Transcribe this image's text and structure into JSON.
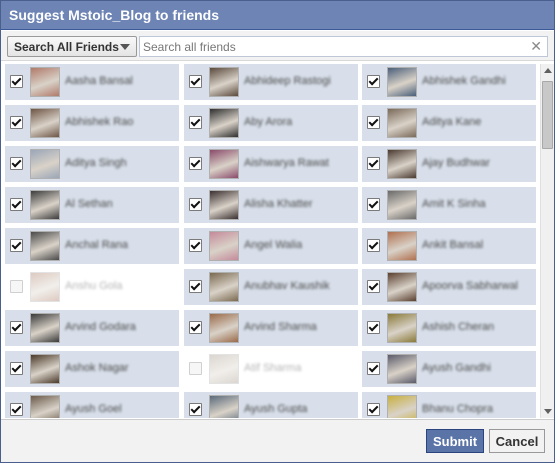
{
  "dialog": {
    "title": "Suggest Mstoic_Blog to friends"
  },
  "toolbar": {
    "filter_label": "Search All Friends",
    "search_placeholder": "Search all friends",
    "clear_icon": "close-icon"
  },
  "friends": [
    {
      "name": "Aasha Bansal",
      "checked": true,
      "color": "#b07a6a"
    },
    {
      "name": "Abhideep Rastogi",
      "checked": true,
      "color": "#5a4a3c"
    },
    {
      "name": "Abhishek Gandhi",
      "checked": true,
      "color": "#4a5f7a"
    },
    {
      "name": "Abhishek Rao",
      "checked": true,
      "color": "#6e5545"
    },
    {
      "name": "Aby Arora",
      "checked": true,
      "color": "#2f2f2f"
    },
    {
      "name": "Aditya Kane",
      "checked": true,
      "color": "#7a6a5a"
    },
    {
      "name": "Aditya Singh",
      "checked": true,
      "color": "#9aa6b8"
    },
    {
      "name": "Aishwarya Rawat",
      "checked": true,
      "color": "#8a4a6a"
    },
    {
      "name": "Ajay Budhwar",
      "checked": true,
      "color": "#4a3a30"
    },
    {
      "name": "Al Sethan",
      "checked": true,
      "color": "#3c3c3c"
    },
    {
      "name": "Alisha Khatter",
      "checked": true,
      "color": "#3a3030"
    },
    {
      "name": "Amit K Sinha",
      "checked": true,
      "color": "#6a6a6a"
    },
    {
      "name": "Anchal Rana",
      "checked": true,
      "color": "#4a4a4a"
    },
    {
      "name": "Angel Walia",
      "checked": true,
      "color": "#c48a9a"
    },
    {
      "name": "Ankit Bansal",
      "checked": true,
      "color": "#b07050"
    },
    {
      "name": "Anshu Gola",
      "checked": false,
      "color": "#a06a50"
    },
    {
      "name": "Anubhav Kaushik",
      "checked": true,
      "color": "#7a6a50"
    },
    {
      "name": "Apoorva Sabharwal",
      "checked": true,
      "color": "#5a4030"
    },
    {
      "name": "Arvind Godara",
      "checked": true,
      "color": "#3a3a3a"
    },
    {
      "name": "Arvind Sharma",
      "checked": true,
      "color": "#9a6a4a"
    },
    {
      "name": "Ashish Cheran",
      "checked": true,
      "color": "#8a7a3a"
    },
    {
      "name": "Ashok Nagar",
      "checked": true,
      "color": "#4a3a2a"
    },
    {
      "name": "Atif Sharma",
      "checked": false,
      "color": "#9a8a7a"
    },
    {
      "name": "Ayush Gandhi",
      "checked": true,
      "color": "#5a5a6a"
    },
    {
      "name": "Ayush Goel",
      "checked": true,
      "color": "#6a5a4a"
    },
    {
      "name": "Ayush Gupta",
      "checked": true,
      "color": "#5a6a7a"
    },
    {
      "name": "Bhanu Chopra",
      "checked": true,
      "color": "#c8b040"
    }
  ],
  "footer": {
    "submit_label": "Submit",
    "cancel_label": "Cancel"
  }
}
